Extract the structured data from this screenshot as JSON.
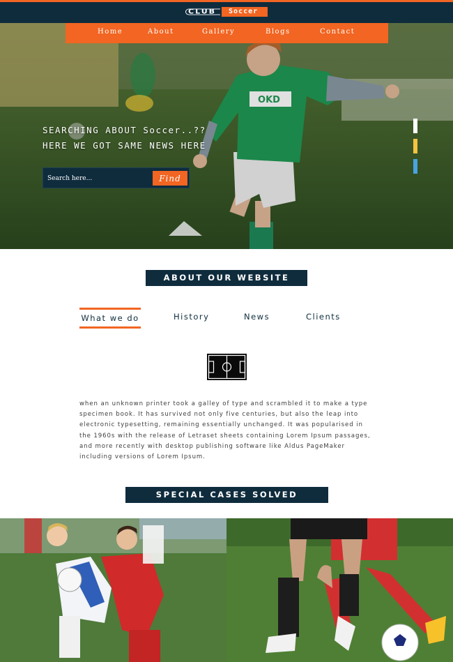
{
  "brand": {
    "club": "CLUB",
    "soccer": "Soccer"
  },
  "nav": {
    "items": [
      "Home",
      "About",
      "Gallery",
      "Blogs",
      "Contact"
    ]
  },
  "hero": {
    "line1": "SEARCHING ABOUT Soccer..??",
    "line2": "HERE WE GOT SAME NEWS HERE",
    "jersey_text": "OKD",
    "search_placeholder": "Search here...",
    "find_label": "Find",
    "slider_colors": [
      "#ffffff",
      "#f5c242",
      "#4aa3df"
    ]
  },
  "about": {
    "heading": "ABOUT OUR WEBSITE",
    "tabs": [
      "What we do",
      "History",
      "News",
      "Clients"
    ],
    "active_tab": "What we do",
    "body": "when an unknown printer took a galley of type and scrambled it to make a type specimen book. It has survived not only five centuries, but also the leap into electronic typesetting, remaining essentially unchanged. It was popularised in the 1960s with the release of Letraset sheets containing Lorem Ipsum passages, and more recently with desktop publishing software like Aldus PageMaker including versions of Lorem Ipsum."
  },
  "cases": {
    "heading": "SPECIAL CASES SOLVED"
  },
  "colors": {
    "navy": "#0f2c3d",
    "orange": "#f26522"
  },
  "icons": [
    "soccer-field-icon"
  ]
}
